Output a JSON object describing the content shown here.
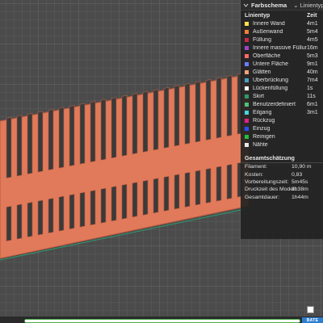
{
  "colors": {
    "model_fill": "#e07a5a",
    "model_edge": "#b95a40",
    "slot": "#3a3a3a",
    "accent": "#4cae4c"
  },
  "panel": {
    "title": "Farbschema",
    "selector_value": "Linientyp",
    "col_type": "Linientyp",
    "col_time": "Zeit",
    "legend": [
      {
        "name": "Innere Wand",
        "time": "4m1",
        "color": "#ffe14a"
      },
      {
        "name": "Außenwand",
        "time": "5m4",
        "color": "#f57c35"
      },
      {
        "name": "Füllung",
        "time": "4m5",
        "color": "#c8284a"
      },
      {
        "name": "Innere massive Füllung",
        "time": "16m",
        "color": "#9c44c8"
      },
      {
        "name": "Oberfläche",
        "time": "5m3",
        "color": "#ff6a6a"
      },
      {
        "name": "Untere Fläche",
        "time": "9m1",
        "color": "#6a7cff"
      },
      {
        "name": "Glätten",
        "time": "40m",
        "color": "#f5a07a"
      },
      {
        "name": "Überbrückung",
        "time": "7m4",
        "color": "#4aa0c8"
      },
      {
        "name": "Lückenfüllung",
        "time": "1s",
        "color": "#ffffff"
      },
      {
        "name": "Skirt",
        "time": "11s",
        "color": "#2e9a6e"
      },
      {
        "name": "Benutzerdefiniert",
        "time": "6m1",
        "color": "#4ec07a"
      },
      {
        "name": "Eilgang",
        "time": "3m1",
        "color": "#40d8e0"
      },
      {
        "name": "Rückzug",
        "time": "",
        "color": "#e0208a"
      },
      {
        "name": "Einzug",
        "time": "",
        "color": "#2850ff"
      },
      {
        "name": "Reinigen",
        "time": "",
        "color": "#20c040"
      },
      {
        "name": "Nähte",
        "time": "",
        "color": "#e8e8e8"
      }
    ],
    "estimate_title": "Gesamtschätzung",
    "stats": [
      {
        "label": "Filament:",
        "value": "10,90 m"
      },
      {
        "label": "Kosten:",
        "value": "0,83"
      },
      {
        "label": "Vorbereitungszeit:",
        "value": "5m45s"
      },
      {
        "label": "Druckzeit des Modell:",
        "value": "1h38m"
      },
      {
        "label": "Gesamtdauer:",
        "value": "1h44m"
      }
    ]
  },
  "progress": {
    "fraction": 1.0
  },
  "slice_button": "BATE"
}
